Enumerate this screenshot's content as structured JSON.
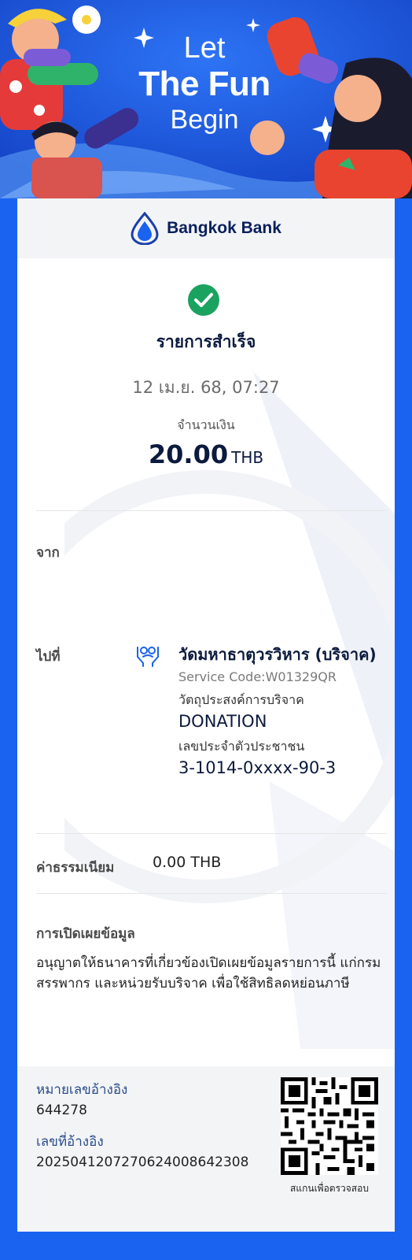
{
  "banner": {
    "line1": "Let",
    "line2": "The Fun",
    "line3": "Begin"
  },
  "bank": {
    "name": "Bangkok Bank"
  },
  "status": {
    "label": "รายการสำเร็จ",
    "color": "#1aa260"
  },
  "datetime": "12 เม.ย. 68, 07:27",
  "amount": {
    "label": "จำนวนเงิน",
    "value": "20.00",
    "currency": "THB"
  },
  "from": {
    "label": "จาก"
  },
  "to": {
    "label": "ไปที่",
    "icon": "donation-hands-icon",
    "name": "วัดมหาธาตุวรวิหาร (บริจาค)",
    "service_code": "Service Code:W01329QR",
    "purpose_label": "วัตถุประสงค์การบริจาค",
    "purpose_value": "DONATION",
    "id_label": "เลขประจำตัวประชาชน",
    "id_value": "3-1014-0xxxx-90-3"
  },
  "fee": {
    "label": "ค่าธรรมเนียม",
    "value": "0.00 THB"
  },
  "disclosure": {
    "label": "การเปิดเผยข้อมูล",
    "text": "อนุญาตให้ธนาคารที่เกี่ยวข้องเปิดเผยข้อมูลรายการนี้ แก่กรมสรรพากร และหน่วยรับบริจาค เพื่อใช้สิทธิลดหย่อนภาษี"
  },
  "reference": {
    "ref_label": "หมายเลขอ้างอิง",
    "ref_value": "644278",
    "ref2_label": "เลขที่อ้างอิง",
    "ref2_value": "2025041207270624008642308",
    "qr_caption": "สแกนเพื่อตรวจสอบ"
  },
  "colors": {
    "brand_blue": "#1a63f0",
    "navy": "#0c1a3d"
  }
}
